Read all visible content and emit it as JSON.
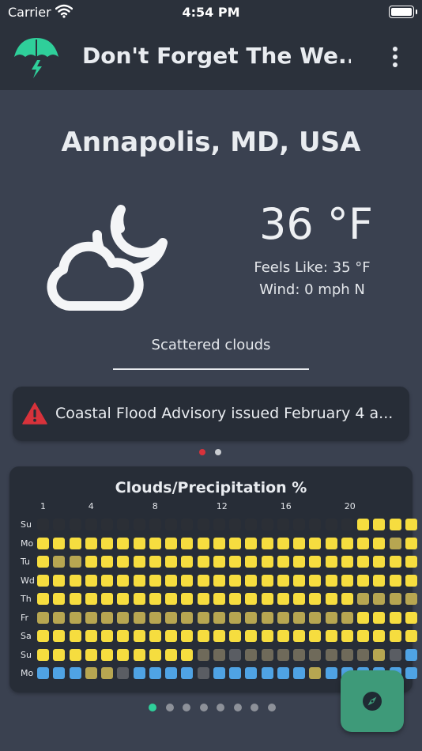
{
  "status_bar": {
    "carrier": "Carrier",
    "time": "4:54 PM"
  },
  "app_bar": {
    "title": "Don't Forget The We...",
    "logo_icon": "umbrella-lightning-icon",
    "menu_icon": "more-vertical-icon"
  },
  "weather": {
    "city": "Annapolis, MD, USA",
    "icon": "cloud-moon-icon",
    "temperature": "36 °F",
    "feels_like": "Feels Like: 35 °F",
    "wind": "Wind: 0 mph N",
    "condition": "Scattered clouds"
  },
  "alert": {
    "icon": "warning-triangle-icon",
    "text": "Coastal Flood Advisory issued February 4 a...",
    "page_count": 2,
    "active_page": 0
  },
  "forecast_grid": {
    "title": "Clouds/Precipitation %",
    "hour_labels": [
      "1",
      "4",
      "8",
      "12",
      "16",
      "20"
    ],
    "hour_label_columns": [
      0,
      3,
      7,
      11,
      15,
      19
    ],
    "days": [
      "Su",
      "Mo",
      "Tu",
      "Wd",
      "Th",
      "Fr",
      "Sa",
      "Su",
      "Mo"
    ],
    "rows": [
      "DDDDDDDDDDDDDDDDDDDDYYYY",
      "YYYYYYYYYYYYYYYYYYYYYYKY",
      "YKKYYYYYYYYYYYYYYYYYYYYY",
      "YYYYYYYYYYYYYYYYYYYYYYYY",
      "YYYYYYYYYYYYYYYYYYYYKKKK",
      "KKKKKKKKKKKKKKKKKKKKYYYY",
      "YYYYYYYYYYYYYYYYYYYYYYYY",
      "YYYYYYYYYYGGLGGGGGGGGKLB",
      "BBBKKLBBBBLBBBBBBKBBBBBB"
    ],
    "colors": {
      "D": "#2b2f36",
      "Y": "#f6dd3f",
      "K": "#b7a651",
      "G": "#6f6a5a",
      "L": "#5a5d63",
      "B": "#4fa3e4"
    }
  },
  "page_indicator": {
    "count": 8,
    "active": 0,
    "active_color": "#2fcf9a",
    "inactive_color": "#8d9199"
  },
  "fab": {
    "icon": "compass-icon"
  }
}
